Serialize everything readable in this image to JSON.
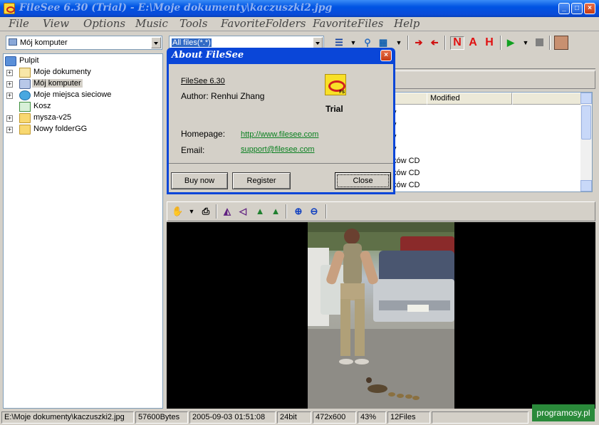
{
  "window": {
    "title": "FileSee 6.30 (Trial) - E:\\Moje dokumenty\\kaczuszki2.jpg"
  },
  "menu": [
    "File",
    "View",
    "Options",
    "Music",
    "Tools",
    "FavoriteFolders",
    "FavoriteFiles",
    "Help"
  ],
  "toolbar": {
    "location": "Mój komputer",
    "filter": "All files(*.*)",
    "n_label": "N",
    "a_label": "A",
    "h_label": "H"
  },
  "tree": {
    "root": "Pulpit",
    "items": [
      "Moje dokumenty",
      "Mój komputer",
      "Moje miejsca sieciowe",
      "Kosz",
      "mysza-v25",
      "Nowy folderGG"
    ]
  },
  "filelist": {
    "columns": [
      "Modified"
    ],
    "rows": [
      "y",
      "y",
      "y",
      "y",
      "ków CD",
      "ków CD",
      "ków CD"
    ]
  },
  "dialog": {
    "title": "About FileSee",
    "version": "FileSee 6.30",
    "author": "Author:  Renhui  Zhang",
    "trial": "Trial",
    "homepage_label": "Homepage:",
    "homepage_url": "http://www.filesee.com",
    "email_label": "Email:",
    "email": "support@filesee.com",
    "buttons": {
      "buy": "Buy now",
      "register": "Register",
      "close": "Close"
    }
  },
  "status": {
    "path": "E:\\Moje dokumenty\\kaczuszki2.jpg",
    "size": "57600Bytes",
    "date": "2005-09-03 01:51:08",
    "depth": "24bit",
    "dims": "472x600",
    "zoom": "43%",
    "files": "12Files"
  },
  "watermark": "programosy.pl"
}
